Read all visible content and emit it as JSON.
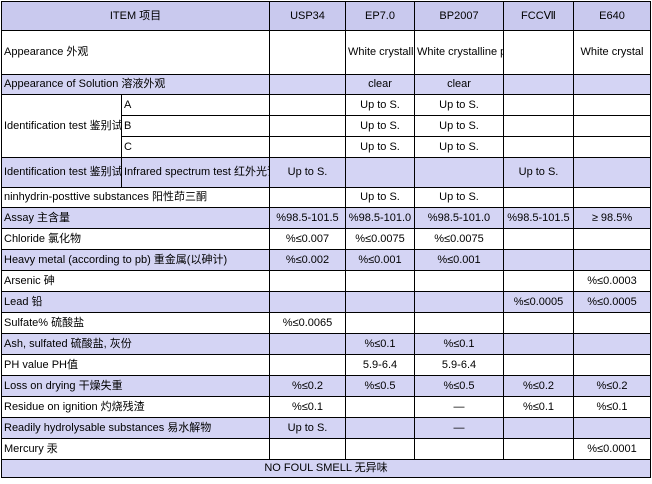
{
  "header": {
    "item": "ITEM 项目",
    "usp": "USP34",
    "ep": "EP7.0",
    "bp": "BP2007",
    "fcc": "FCCⅦ",
    "e": "E640"
  },
  "rows": {
    "appearance": {
      "label": "Appearance  外观",
      "ep": "White crystalline powder",
      "bp": "White crystalline powder",
      "e": "White crystal"
    },
    "solution": {
      "label": "Appearance of Solution  溶液外观",
      "ep": "clear",
      "bp": "clear"
    },
    "ident": {
      "label": "Identification test 鉴别试验 (firstA, secondB,C)",
      "a": "A",
      "b": "B",
      "c": "C",
      "a_ep": "Up to S.",
      "a_bp": "Up to S.",
      "b_ep": "Up to S.",
      "b_bp": "Up to S.",
      "c_ep": "Up to S.",
      "c_bp": "Up to S."
    },
    "ident_ir": {
      "label": "Identification test 鉴别试验",
      "sub": "Infrared spectrum test 红外光谱试验",
      "usp": "Up to S.",
      "fcc": "Up to S."
    },
    "ninhydrin": {
      "label": "ninhydrin-posttive substances 阳性茚三酮",
      "ep": "Up to S.",
      "bp": "Up to S."
    },
    "assay": {
      "label": "Assay 主含量",
      "usp": "%98.5-101.5",
      "ep": "%98.5-101.0",
      "bp": "%98.5-101.0",
      "fcc": "%98.5-101.5",
      "e": "≥ 98.5%"
    },
    "chloride": {
      "label": "Chloride 氯化物",
      "usp": "%≤0.007",
      "ep": "%≤0.0075",
      "bp": "%≤0.0075"
    },
    "heavy": {
      "label": "Heavy metal (according to pb) 重金属(以砷计)",
      "usp": "%≤0.002",
      "ep": "%≤0.001",
      "bp": "%≤0.001"
    },
    "arsenic": {
      "label": "Arsenic 砷",
      "e": "%≤0.0003"
    },
    "lead": {
      "label": "Lead 铅",
      "fcc": "%≤0.0005",
      "e": "%≤0.0005"
    },
    "sulfate": {
      "label": "Sulfate% 硫酸盐",
      "usp": "%≤0.0065"
    },
    "ash": {
      "label": "Ash, sulfated 硫酸盐, 灰份",
      "ep": "%≤0.1",
      "bp": "%≤0.1"
    },
    "ph": {
      "label": "PH value PH值",
      "ep": "5.9-6.4",
      "bp": "5.9-6.4"
    },
    "loss": {
      "label": "Loss on drying 干燥失重",
      "usp": "%≤0.2",
      "ep": "%≤0.5",
      "bp": "%≤0.5",
      "fcc": "%≤0.2",
      "e": "%≤0.2"
    },
    "residue": {
      "label": "Residue on ignition 灼烧残渣",
      "usp": "%≤0.1",
      "bp": "—",
      "fcc": "%≤0.1",
      "e": "%≤0.1"
    },
    "hydro": {
      "label": "Readily hydrolysable substances 易水解物",
      "usp": "Up to S.",
      "bp": "—"
    },
    "mercury": {
      "label": "Mercury 汞",
      "e": "%≤0.0001"
    }
  },
  "footer": "NO FOUL SMELL 无异味",
  "colors": {
    "header_fill": "#c9c9ee",
    "shaded_row": "#d4d4f4",
    "border": "#000000"
  }
}
